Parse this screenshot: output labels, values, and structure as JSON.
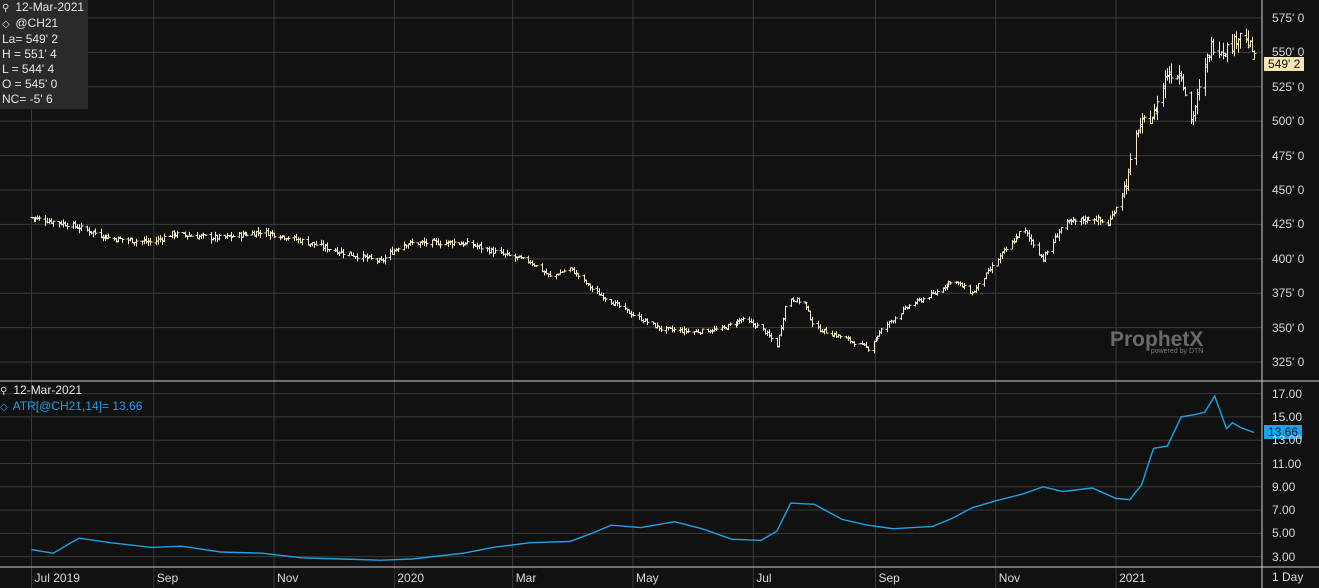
{
  "price_panel": {
    "date": "12-Mar-2021",
    "symbol": "@CH21",
    "stats": [
      "La= 549' 2",
      "H = 551' 4",
      "L = 544' 4",
      "O = 545' 0",
      "NC= -5' 6"
    ],
    "last_badge": "549' 2"
  },
  "atr_panel": {
    "date": "12-Mar-2021",
    "label": "ATR[@CH21,14]= 13.66",
    "last_badge": "13.66"
  },
  "watermark": {
    "brand": "ProphetX",
    "sub": "powered by DTN"
  },
  "timeframe": "1 Day",
  "colors": {
    "background": "#111111",
    "bars": "#f0e6c8",
    "atr_line": "#1aa3e8",
    "grid": "#3a3a3a"
  },
  "chart_data": [
    {
      "type": "ohlc",
      "title": "@CH21",
      "y_ticks": [
        "325' 0",
        "350' 0",
        "375' 0",
        "400' 0",
        "425' 0",
        "450' 0",
        "475' 0",
        "500' 0",
        "525' 0",
        "550' 0",
        "575' 0"
      ],
      "ylim": [
        312,
        588
      ],
      "x_ticks": [
        "Jul 2019",
        "Sep",
        "Nov",
        "2020",
        "Mar",
        "May",
        "Jul",
        "Sep",
        "Nov",
        "2021"
      ],
      "close_anchors": [
        [
          "2019-07-01",
          430
        ],
        [
          "2019-07-20",
          425
        ],
        [
          "2019-08-10",
          415
        ],
        [
          "2019-08-31",
          412
        ],
        [
          "2019-09-10",
          418
        ],
        [
          "2019-10-05",
          415
        ],
        [
          "2019-10-26",
          420
        ],
        [
          "2019-11-10",
          415
        ],
        [
          "2019-12-05",
          405
        ],
        [
          "2019-12-25",
          398
        ],
        [
          "2020-01-05",
          411
        ],
        [
          "2020-01-31",
          412
        ],
        [
          "2020-02-10",
          410
        ],
        [
          "2020-02-25",
          403
        ],
        [
          "2020-03-10",
          398
        ],
        [
          "2020-03-20",
          387
        ],
        [
          "2020-03-30",
          393
        ],
        [
          "2020-04-10",
          378
        ],
        [
          "2020-04-30",
          360
        ],
        [
          "2020-05-15",
          349
        ],
        [
          "2020-06-01",
          347
        ],
        [
          "2020-06-15",
          349
        ],
        [
          "2020-06-25",
          356
        ],
        [
          "2020-07-05",
          350
        ],
        [
          "2020-07-13",
          337
        ],
        [
          "2020-07-18",
          372
        ],
        [
          "2020-07-27",
          368
        ],
        [
          "2020-08-01",
          350
        ],
        [
          "2020-08-15",
          343
        ],
        [
          "2020-08-28",
          335
        ],
        [
          "2020-09-05",
          350
        ],
        [
          "2020-09-18",
          366
        ],
        [
          "2020-10-01",
          375
        ],
        [
          "2020-10-10",
          385
        ],
        [
          "2020-10-20",
          375
        ],
        [
          "2020-11-01",
          398
        ],
        [
          "2020-11-15",
          422
        ],
        [
          "2020-11-25",
          400
        ],
        [
          "2020-12-05",
          425
        ],
        [
          "2020-12-20",
          430
        ],
        [
          "2020-12-28",
          425
        ],
        [
          "2021-01-06",
          455
        ],
        [
          "2021-01-12",
          495
        ],
        [
          "2021-01-20",
          505
        ],
        [
          "2021-01-27",
          535
        ],
        [
          "2021-02-03",
          535
        ],
        [
          "2021-02-08",
          500
        ],
        [
          "2021-02-18",
          555
        ],
        [
          "2021-02-24",
          552
        ],
        [
          "2021-03-01",
          555
        ],
        [
          "2021-03-05",
          565
        ],
        [
          "2021-03-12",
          549.25
        ]
      ],
      "last": {
        "open": 545.0,
        "high": 551.5,
        "low": 544.5,
        "close": 549.25,
        "change": -5.75
      }
    },
    {
      "type": "line",
      "title": "ATR[@CH21,14]",
      "y_ticks": [
        "3.00",
        "5.00",
        "7.00",
        "9.00",
        "11.00",
        "13.00",
        "15.00",
        "17.00"
      ],
      "ylim": [
        2.2,
        18
      ],
      "series": [
        {
          "name": "ATR[@CH21,14]",
          "points": [
            [
              "2019-07-01",
              3.6
            ],
            [
              "2019-07-12",
              3.3
            ],
            [
              "2019-07-25",
              4.6
            ],
            [
              "2019-08-10",
              4.2
            ],
            [
              "2019-08-31",
              3.8
            ],
            [
              "2019-09-15",
              3.9
            ],
            [
              "2019-10-05",
              3.4
            ],
            [
              "2019-10-26",
              3.3
            ],
            [
              "2019-11-15",
              2.9
            ],
            [
              "2019-12-05",
              2.8
            ],
            [
              "2019-12-25",
              2.7
            ],
            [
              "2020-01-10",
              2.8
            ],
            [
              "2020-02-05",
              3.3
            ],
            [
              "2020-02-20",
              3.8
            ],
            [
              "2020-03-10",
              4.2
            ],
            [
              "2020-03-30",
              4.3
            ],
            [
              "2020-04-10",
              5.0
            ],
            [
              "2020-04-20",
              5.7
            ],
            [
              "2020-05-05",
              5.5
            ],
            [
              "2020-05-22",
              6.0
            ],
            [
              "2020-06-05",
              5.4
            ],
            [
              "2020-06-20",
              4.5
            ],
            [
              "2020-07-05",
              4.4
            ],
            [
              "2020-07-13",
              5.2
            ],
            [
              "2020-07-20",
              7.6
            ],
            [
              "2020-08-01",
              7.5
            ],
            [
              "2020-08-15",
              6.2
            ],
            [
              "2020-08-28",
              5.7
            ],
            [
              "2020-09-10",
              5.4
            ],
            [
              "2020-09-30",
              5.6
            ],
            [
              "2020-10-10",
              6.3
            ],
            [
              "2020-10-20",
              7.2
            ],
            [
              "2020-11-01",
              7.8
            ],
            [
              "2020-11-15",
              8.4
            ],
            [
              "2020-11-25",
              9.0
            ],
            [
              "2020-12-05",
              8.6
            ],
            [
              "2020-12-20",
              8.9
            ],
            [
              "2021-01-01",
              8.0
            ],
            [
              "2021-01-08",
              7.9
            ],
            [
              "2021-01-14",
              9.2
            ],
            [
              "2021-01-20",
              12.3
            ],
            [
              "2021-01-27",
              12.5
            ],
            [
              "2021-02-03",
              15.0
            ],
            [
              "2021-02-10",
              15.2
            ],
            [
              "2021-02-15",
              15.4
            ],
            [
              "2021-02-20",
              16.8
            ],
            [
              "2021-02-26",
              14.0
            ],
            [
              "2021-03-01",
              14.5
            ],
            [
              "2021-03-05",
              14.1
            ],
            [
              "2021-03-12",
              13.66
            ]
          ]
        }
      ]
    }
  ]
}
